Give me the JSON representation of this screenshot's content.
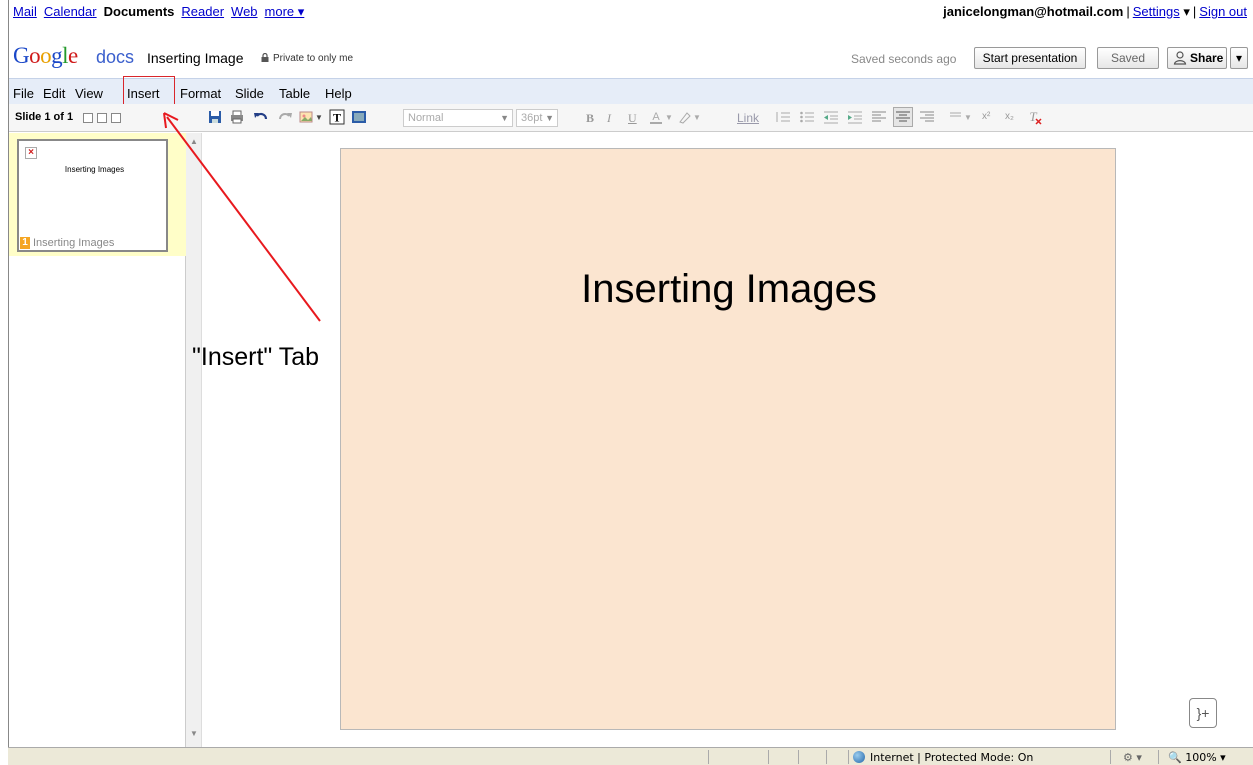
{
  "nav": {
    "links": [
      "Mail",
      "Calendar"
    ],
    "current": "Documents",
    "links_after": [
      "Reader",
      "Web"
    ],
    "more": "more ▾",
    "email": "janicelongman@hotmail.com",
    "settings": "Settings",
    "settings_arrow": "▾",
    "sign_out": "Sign out"
  },
  "header": {
    "logo_text": "Google",
    "logo_docs": "docs",
    "doc_title": "Inserting Image",
    "privacy": "Private to only me",
    "save_status": "Saved seconds ago",
    "start_presentation": "Start presentation",
    "saved_button": "Saved",
    "share": "Share",
    "share_dropdown": "▾"
  },
  "menubar": {
    "items": [
      "File",
      "Edit",
      "View",
      "Insert",
      "Format",
      "Slide",
      "Table",
      "Help"
    ]
  },
  "toolbar": {
    "slide_count": "Slide 1 of 1",
    "style": "Normal",
    "size": "36pt",
    "bold": "B",
    "italic": "I",
    "underline": "U",
    "link": "Link",
    "superscript": "x²",
    "subscript": "x₂"
  },
  "slides": [
    {
      "number": "1",
      "title": "Inserting Images",
      "label": "Inserting Images"
    }
  ],
  "slide": {
    "title": "Inserting Images",
    "background": "#fbe5d0"
  },
  "annotation": {
    "label": "\"Insert\" Tab",
    "color": "#e8191e"
  },
  "statusbar": {
    "zone": "Internet | Protected Mode: On",
    "zoom": "100%",
    "zoom_arrow": "▾"
  }
}
